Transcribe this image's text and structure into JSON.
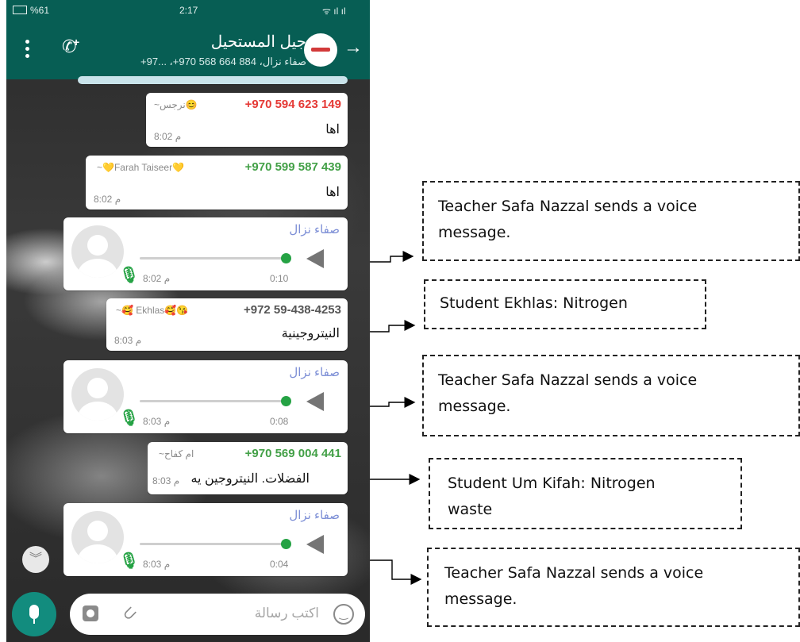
{
  "status_bar": {
    "battery": "%61",
    "time": "2:17"
  },
  "chat_header": {
    "group_name": "جيل المستحيل",
    "participants": "صفاء نزال، 884 664 568 970+، ...97+"
  },
  "messages": [
    {
      "phone": "+970 594 623 149",
      "alias": "~نرجس😊",
      "text": "اها",
      "time": "8:02 م",
      "phone_color": "#e53935"
    },
    {
      "phone": "+970 599 587 439",
      "alias": "~💛Farah Taiseer💛",
      "text": "اها",
      "time": "8:02 م",
      "phone_color": "#43a047"
    },
    {
      "sender": "صفاء نزال",
      "duration": "0:10",
      "time": "8:02 م",
      "progress": 1.0
    },
    {
      "phone": "+972 59-438-4253",
      "alias": "~🥰 Ekhlas🥰😘",
      "text": "النيتروجينية",
      "time": "8:03 م",
      "phone_color": "#555555"
    },
    {
      "sender": "صفاء نزال",
      "duration": "0:08",
      "time": "8:03 م",
      "progress": 1.0
    },
    {
      "phone": "+970 569 004 441",
      "alias": "~ام كفاح",
      "text": "الفضلات. النيتروجين يه",
      "time": "8:03 م",
      "phone_color": "#43a047"
    },
    {
      "sender": "صفاء نزال",
      "duration": "0:04",
      "time": "8:03 م",
      "progress": 1.0
    }
  ],
  "input_bar": {
    "placeholder": "اكتب رسالة"
  },
  "annotations": [
    {
      "lines": [
        "Teacher Safa Nazzal sends a voice",
        "message."
      ]
    },
    {
      "lines": [
        "Student Ekhlas: Nitrogen"
      ]
    },
    {
      "lines": [
        "Teacher Safa Nazzal sends a voice",
        "message."
      ]
    },
    {
      "lines": [
        "Student Um Kifah: Nitrogen",
        "waste"
      ]
    },
    {
      "lines": [
        "Teacher Safa Nazzal sends a voice",
        "message."
      ]
    }
  ],
  "colors": {
    "header_green": "#075e54",
    "accent_green": "#25a244",
    "voice_sender": "#7d8fd6"
  }
}
